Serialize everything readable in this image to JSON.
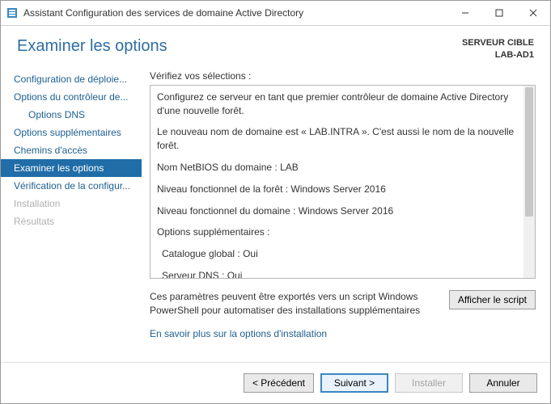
{
  "window_title": "Assistant Configuration des services de domaine Active Directory",
  "page_title": "Examiner les options",
  "target": {
    "label": "SERVEUR CIBLE",
    "value": "LAB-AD1"
  },
  "sidebar": {
    "items": [
      {
        "name": "sidebar-item-deployment",
        "label": "Configuration de déploie...",
        "indent": false,
        "selected": false,
        "disabled": false
      },
      {
        "name": "sidebar-item-dc-options",
        "label": "Options du contrôleur de...",
        "indent": false,
        "selected": false,
        "disabled": false
      },
      {
        "name": "sidebar-item-dns-options",
        "label": "Options DNS",
        "indent": true,
        "selected": false,
        "disabled": false
      },
      {
        "name": "sidebar-item-additional",
        "label": "Options supplémentaires",
        "indent": false,
        "selected": false,
        "disabled": false
      },
      {
        "name": "sidebar-item-paths",
        "label": "Chemins d'accès",
        "indent": false,
        "selected": false,
        "disabled": false
      },
      {
        "name": "sidebar-item-review",
        "label": "Examiner les options",
        "indent": false,
        "selected": true,
        "disabled": false
      },
      {
        "name": "sidebar-item-prereq",
        "label": "Vérification de la configur...",
        "indent": false,
        "selected": false,
        "disabled": false
      },
      {
        "name": "sidebar-item-install",
        "label": "Installation",
        "indent": false,
        "selected": false,
        "disabled": true
      },
      {
        "name": "sidebar-item-results",
        "label": "Résultats",
        "indent": false,
        "selected": false,
        "disabled": true
      }
    ]
  },
  "content": {
    "verify_label": "Vérifiez vos sélections :",
    "lines": [
      {
        "text": "Configurez ce serveur en tant que premier contrôleur de domaine Active Directory d'une nouvelle forêt.",
        "sub": false
      },
      {
        "text": "Le nouveau nom de domaine est « LAB.INTRA ». C'est aussi le nom de la nouvelle forêt.",
        "sub": false
      },
      {
        "text": "Nom NetBIOS du domaine : LAB",
        "sub": false
      },
      {
        "text": "Niveau fonctionnel de la forêt : Windows Server 2016",
        "sub": false
      },
      {
        "text": "Niveau fonctionnel du domaine : Windows Server 2016",
        "sub": false
      },
      {
        "text": "Options supplémentaires :",
        "sub": false
      },
      {
        "text": "Catalogue global : Oui",
        "sub": true
      },
      {
        "text": "Serveur DNS : Oui",
        "sub": true
      }
    ],
    "export_text": "Ces paramètres peuvent être exportés vers un script Windows PowerShell pour automatiser des installations supplémentaires",
    "view_script_label": "Afficher le script",
    "learn_more_label": "En savoir plus sur la options d'installation"
  },
  "footer": {
    "previous_label": "< Précédent",
    "next_label": "Suivant >",
    "install_label": "Installer",
    "cancel_label": "Annuler"
  }
}
